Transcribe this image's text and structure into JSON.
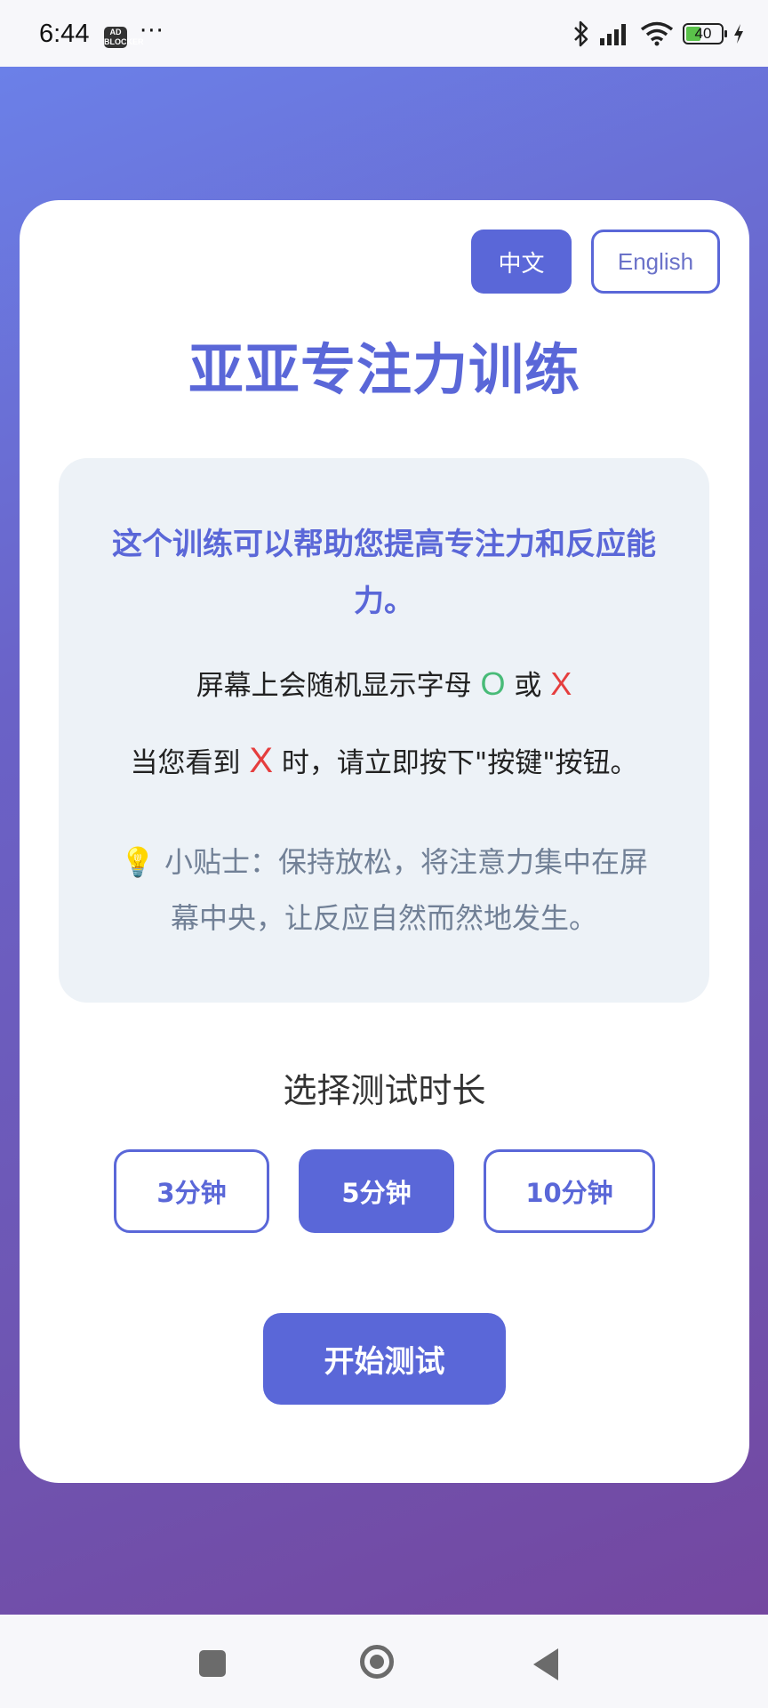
{
  "status_bar": {
    "time": "6:44",
    "ad_badge": "AD\nBLOCKER",
    "dots": "···",
    "battery": "40"
  },
  "app": {
    "languages": {
      "zh": "中文",
      "en": "English",
      "selected": "zh"
    },
    "title": "亚亚专注力训练",
    "intro": "这个训练可以帮助您提高专注力和反应能力。",
    "rule1": {
      "prefix": "屏幕上会随机显示字母 ",
      "letter_o": "O",
      "middle": " 或 ",
      "letter_x": "X"
    },
    "rule2": {
      "prefix": "当您看到 ",
      "letter_x": "X",
      "suffix": " 时，请立即按下\"按键\"按钮。"
    },
    "tip": {
      "icon": "lightbulb-icon",
      "text": "小贴士：保持放松，将注意力集中在屏幕中央，让反应自然而然地发生。"
    },
    "duration_label": "选择测试时长",
    "durations": [
      "3分钟",
      "5分钟",
      "10分钟"
    ],
    "selected_duration": "5分钟",
    "start_button": "开始测试"
  },
  "colors": {
    "accent": "#5a67d8",
    "letter_o": "#48bb78",
    "letter_x": "#e53e3e",
    "tip_text": "#718096",
    "info_bg": "#edf2f7"
  }
}
